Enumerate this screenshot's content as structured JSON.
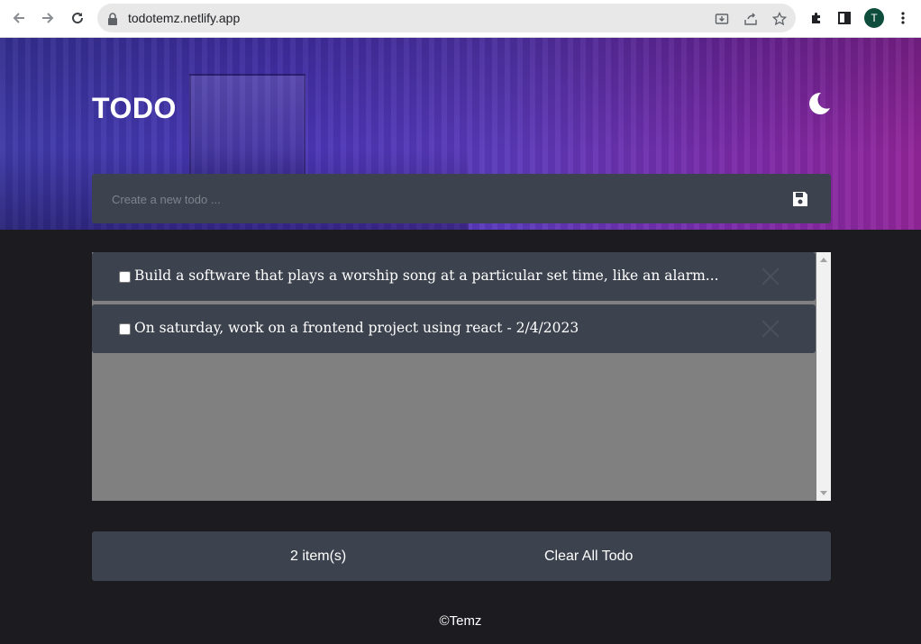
{
  "browser": {
    "url": "todotemz.netlify.app",
    "avatar_letter": "T",
    "icons": [
      "back-arrow-icon",
      "forward-arrow-icon",
      "reload-icon",
      "lock-icon",
      "install-app-icon",
      "share-icon",
      "bookmark-star-icon",
      "extensions-puzzle-icon",
      "side-panel-icon",
      "more-vert-icon"
    ]
  },
  "app": {
    "title": "TODO",
    "theme_icon": "moon-icon",
    "input_placeholder": "Create a new todo ...",
    "save_icon": "floppy-save-icon",
    "todos": [
      {
        "text": "Build a software that plays a worship song at a particular set time, like an alarm...",
        "done": false
      },
      {
        "text": "On saturday, work on a frontend project using react - 2/4/2023",
        "done": false
      }
    ],
    "count_label": "2 item(s)",
    "clear_label": "Clear All Todo",
    "credit": "©Temz"
  },
  "colors": {
    "page_bg": "#1c1b1f",
    "card_bg": "#3d434e",
    "list_bg": "#808080",
    "hero_start": "#3e3aa8",
    "hero_end": "#93269a"
  }
}
